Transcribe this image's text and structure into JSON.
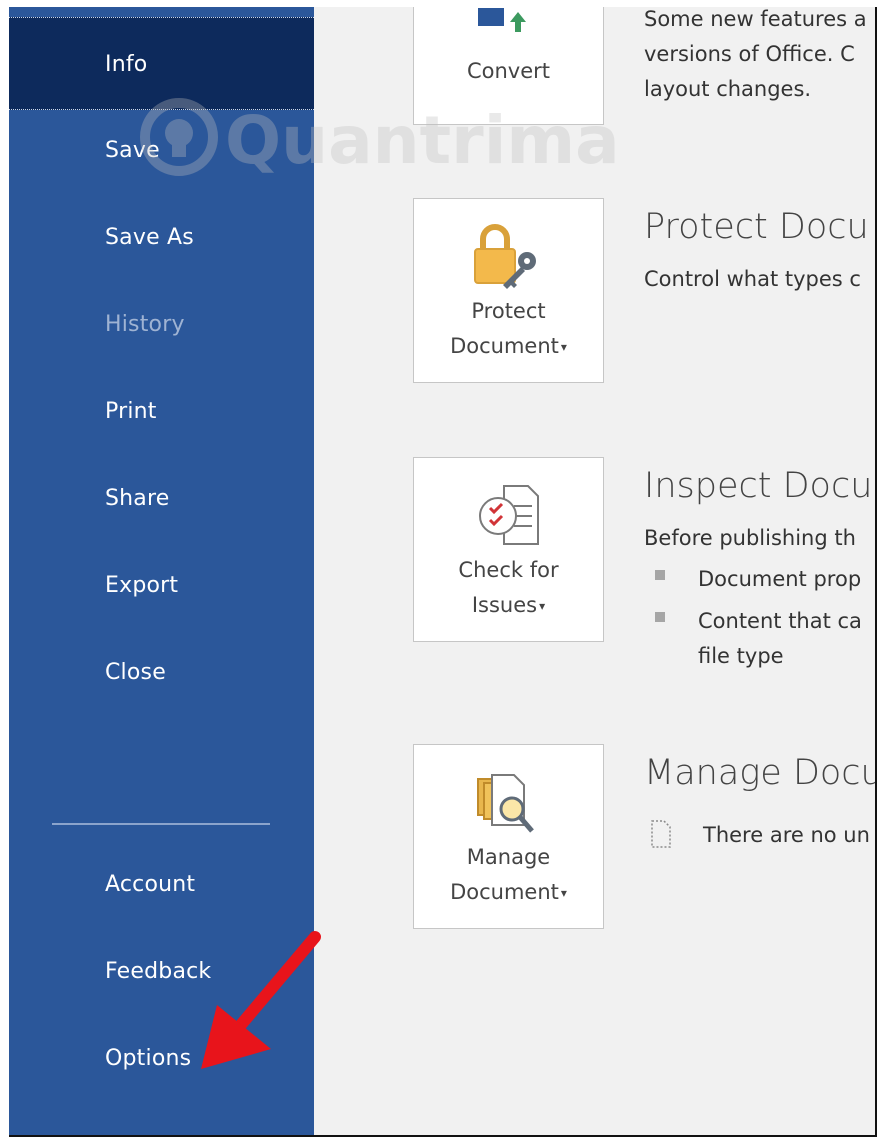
{
  "sidebar": {
    "items": [
      {
        "label": "Info",
        "active": true
      },
      {
        "label": "Save"
      },
      {
        "label": "Save As"
      },
      {
        "label": "History",
        "disabled": true
      },
      {
        "label": "Print"
      },
      {
        "label": "Share"
      },
      {
        "label": "Export"
      },
      {
        "label": "Close"
      },
      {
        "label": "Account"
      },
      {
        "label": "Feedback"
      },
      {
        "label": "Options"
      }
    ]
  },
  "sections": {
    "compat": {
      "tile_label": "Convert",
      "lines": [
        "Some new features a",
        "versions of Office. C",
        "layout changes."
      ]
    },
    "protect": {
      "tile_line1": "Protect",
      "tile_line2": "Document",
      "heading": "Protect Docu",
      "desc": "Control what types c"
    },
    "inspect": {
      "tile_line1": "Check for",
      "tile_line2": "Issues",
      "heading": "Inspect Docu",
      "desc": "Before publishing th",
      "bullets": [
        "Document prop",
        "Content that ca",
        "file type"
      ]
    },
    "manage": {
      "tile_line1": "Manage",
      "tile_line2": "Document",
      "heading": "Manage Docu",
      "desc": "There are no un"
    }
  },
  "watermark": "Quantrimang",
  "colors": {
    "sidebar": "#2b579a",
    "sidebar_active": "#0d2a5c",
    "arrow": "#e8141b"
  }
}
